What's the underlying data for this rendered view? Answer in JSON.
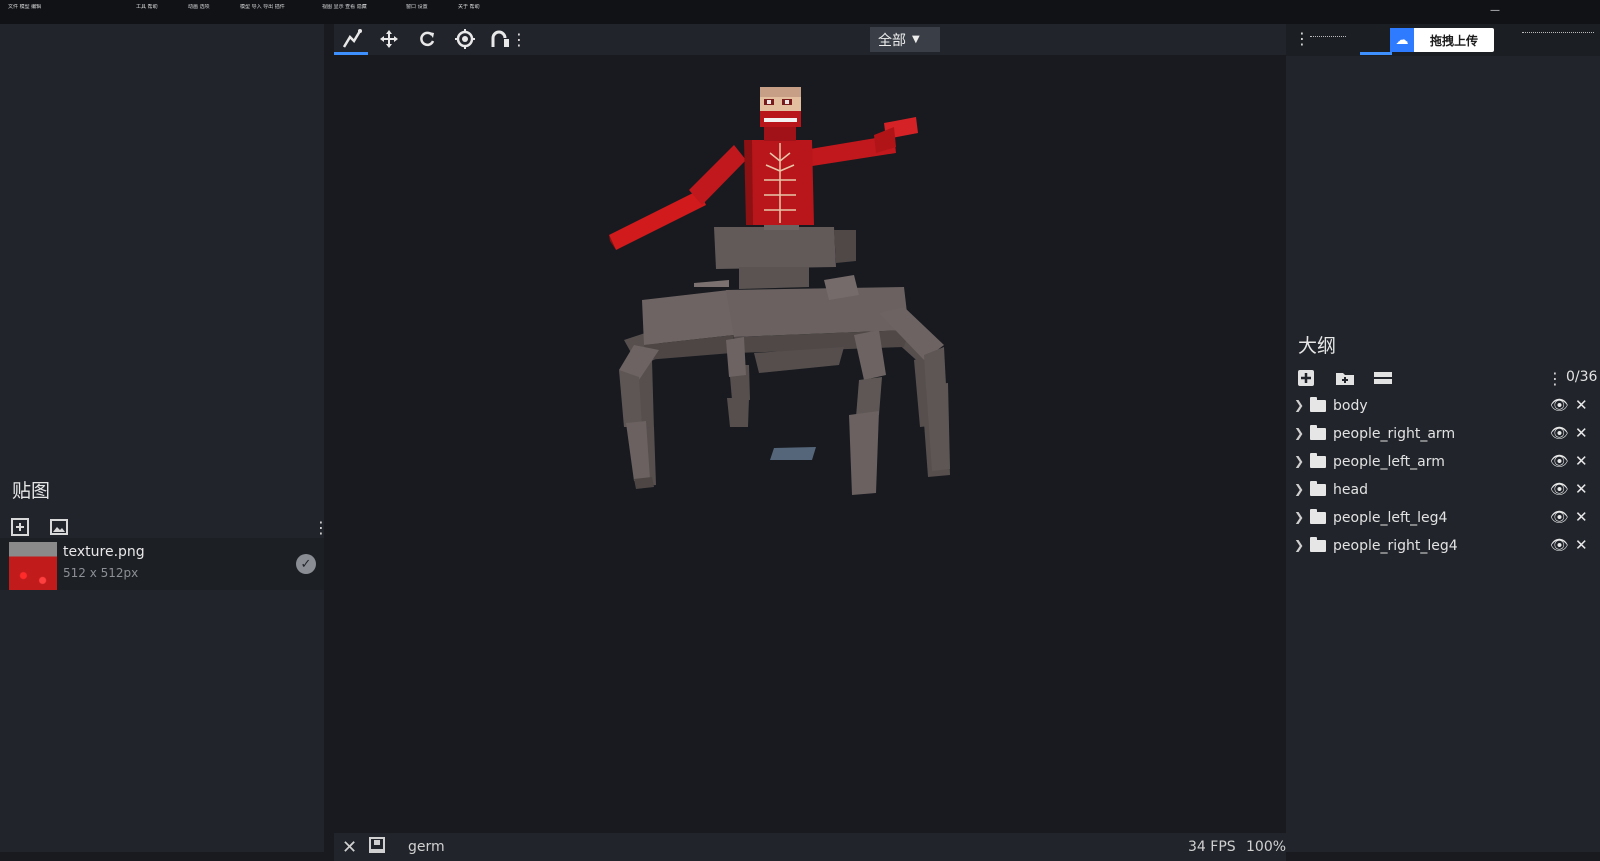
{
  "menu": {
    "items": [
      "文件 模型 编辑",
      "工具 帮助",
      "动画 选项",
      "模型 导入 导出 插件",
      "视图 显示 查看 隐藏",
      "窗口 设置",
      "关于 帮助"
    ]
  },
  "left": {
    "textures_title": "贴图",
    "texture": {
      "name": "texture.png",
      "size": "512 x 512px"
    }
  },
  "toolbar": {
    "scope": "全部"
  },
  "statusbar": {
    "model_name": "germ",
    "fps": "34 FPS",
    "zoom": "100%"
  },
  "right": {
    "upload_label": "拖拽上传",
    "outline_title": "大纲",
    "count": "0/36",
    "groups": [
      {
        "name": "body"
      },
      {
        "name": "people_right_arm"
      },
      {
        "name": "people_left_arm"
      },
      {
        "name": "head"
      },
      {
        "name": "people_left_leg4"
      },
      {
        "name": "people_right_leg4"
      }
    ]
  },
  "colors": {
    "accent": "#3e90ff",
    "titan_red": "#c0181c",
    "stone": "#5f5756"
  }
}
